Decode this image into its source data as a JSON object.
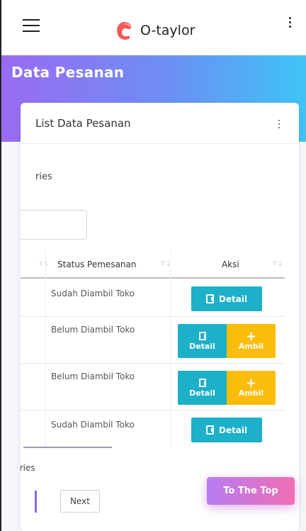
{
  "app": {
    "brand_name": "O-taylor",
    "accent_colors": {
      "header_start": "#9a6bf2",
      "header_end": "#3fc4f6",
      "detail": "#1cb0c9",
      "ambil": "#fbbd0a"
    }
  },
  "header": {
    "title": "Data Pesanan"
  },
  "card": {
    "title": "List Data Pesanan",
    "entries_top": "ries",
    "entries_bottom": "tries",
    "search_value": ""
  },
  "table": {
    "columns": [
      {
        "label": "Status Pemesanan"
      },
      {
        "label": "Aksi"
      }
    ],
    "rows": [
      {
        "status": "Sudah Diambil Toko",
        "actions": [
          "Detail"
        ]
      },
      {
        "status": "Belum Diambil Toko",
        "actions": [
          "Detail",
          "Ambil"
        ]
      },
      {
        "status": "Belum Diambil Toko",
        "actions": [
          "Detail",
          "Ambil"
        ]
      },
      {
        "status": "Sudah Diambil Toko",
        "actions": [
          "Detail"
        ]
      }
    ]
  },
  "pagination": {
    "next_label": "Next"
  },
  "scroll_top": {
    "label": "To The Top"
  },
  "icons": [
    "menu-icon",
    "logo-icon",
    "more-vertical-icon",
    "document-icon",
    "plus-icon",
    "sort-icon"
  ]
}
